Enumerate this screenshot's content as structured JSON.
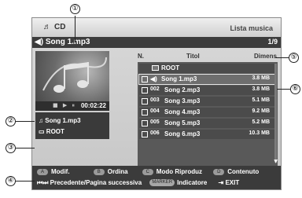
{
  "screen": {
    "app_title": "CD",
    "mode_title": "Lista musica",
    "now_playing": "Song 1.mp3",
    "counter": "1/9",
    "elapsed_time": "00:02:22",
    "info": {
      "song": "Song 1.mp3",
      "folder": "ROOT"
    }
  },
  "list": {
    "headers": {
      "num": "N.",
      "title": "Titol",
      "size": "Dimens"
    },
    "root_label": "ROOT",
    "rows": [
      {
        "num": "",
        "title": "Song 1.mp3",
        "size": "3.8 MB"
      },
      {
        "num": "002",
        "title": "Song 2.mp3",
        "size": "3.8 MB"
      },
      {
        "num": "003",
        "title": "Song 3.mp3",
        "size": "5.1 MB"
      },
      {
        "num": "004",
        "title": "Song 4.mp3",
        "size": "9.2 MB"
      },
      {
        "num": "005",
        "title": "Song 5.mp3",
        "size": "5.2 MB"
      },
      {
        "num": "006",
        "title": "Song 6.mp3",
        "size": "10.3 MB"
      }
    ]
  },
  "footer": {
    "a_key": "A",
    "a_label": "Modif.",
    "b_key": "B",
    "b_label": "Ordina",
    "c_key": "C",
    "c_label": "Modo Riproduz",
    "d_key": "D",
    "d_label": "Contenuto",
    "nav_label": "Precedente/Pagina successiva",
    "marker_key": "MARKER",
    "marker_label": "Indicatore",
    "exit_label": "EXIT"
  },
  "callouts": [
    "①",
    "②",
    "③",
    "④",
    "⑤",
    "⑥"
  ]
}
